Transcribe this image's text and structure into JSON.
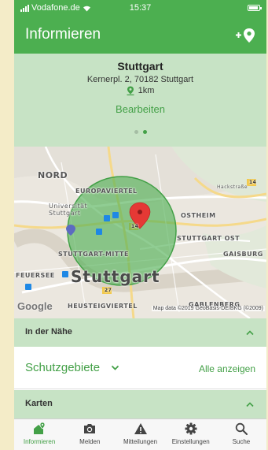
{
  "status_bar": {
    "carrier": "Vodafone.de",
    "time": "15:37"
  },
  "header": {
    "title": "Informieren",
    "add_location_icon": "add-location-icon"
  },
  "location": {
    "city": "Stuttgart",
    "address": "Kernerpl. 2, 70182 Stuttgart",
    "radius": "1km",
    "edit_label": "Bearbeiten",
    "pager_count": 2,
    "pager_active": 1
  },
  "map": {
    "labels": {
      "nord": "NORD",
      "europaviertel": "EUROPAVIERTEL",
      "universitaet": "Universität\nStuttgart",
      "ostheim": "OSTHEIM",
      "stuttgart_ost": "STUTTGART OST",
      "gaisburg": "GAISBURG",
      "stuttgart_mitte": "STUTTGART-MITTE",
      "feuersee": "FEUERSEE",
      "stuttgart": "Stuttgart",
      "heusteigviertel": "HEUSTEIGVIERTEL",
      "gablenberg": "GABLENBERG",
      "hackstrasse": "Hackstraße",
      "road_14a": "14",
      "road_14b": "14",
      "road_27": "27"
    },
    "logo": "Google",
    "attribution": "Map data ©2019 GeoBasis-DE/BKG (©2009)",
    "accent": "#4caf50"
  },
  "sections": {
    "nearby": {
      "title": "In der Nähe"
    },
    "maps": {
      "title": "Karten"
    }
  },
  "filter": {
    "selected": "Schutzgebiete",
    "show_all": "Alle anzeigen"
  },
  "tabs": [
    {
      "label": "Informieren",
      "icon": "home-marker-icon",
      "active": true
    },
    {
      "label": "Melden",
      "icon": "camera-icon",
      "active": false
    },
    {
      "label": "Mitteilungen",
      "icon": "warning-icon",
      "active": false
    },
    {
      "label": "Einstellungen",
      "icon": "gear-icon",
      "active": false
    },
    {
      "label": "Suche",
      "icon": "search-icon",
      "active": false
    }
  ],
  "colors": {
    "primary": "#4caf50",
    "panel": "#c7e3c5",
    "accent_text": "#43a047"
  }
}
